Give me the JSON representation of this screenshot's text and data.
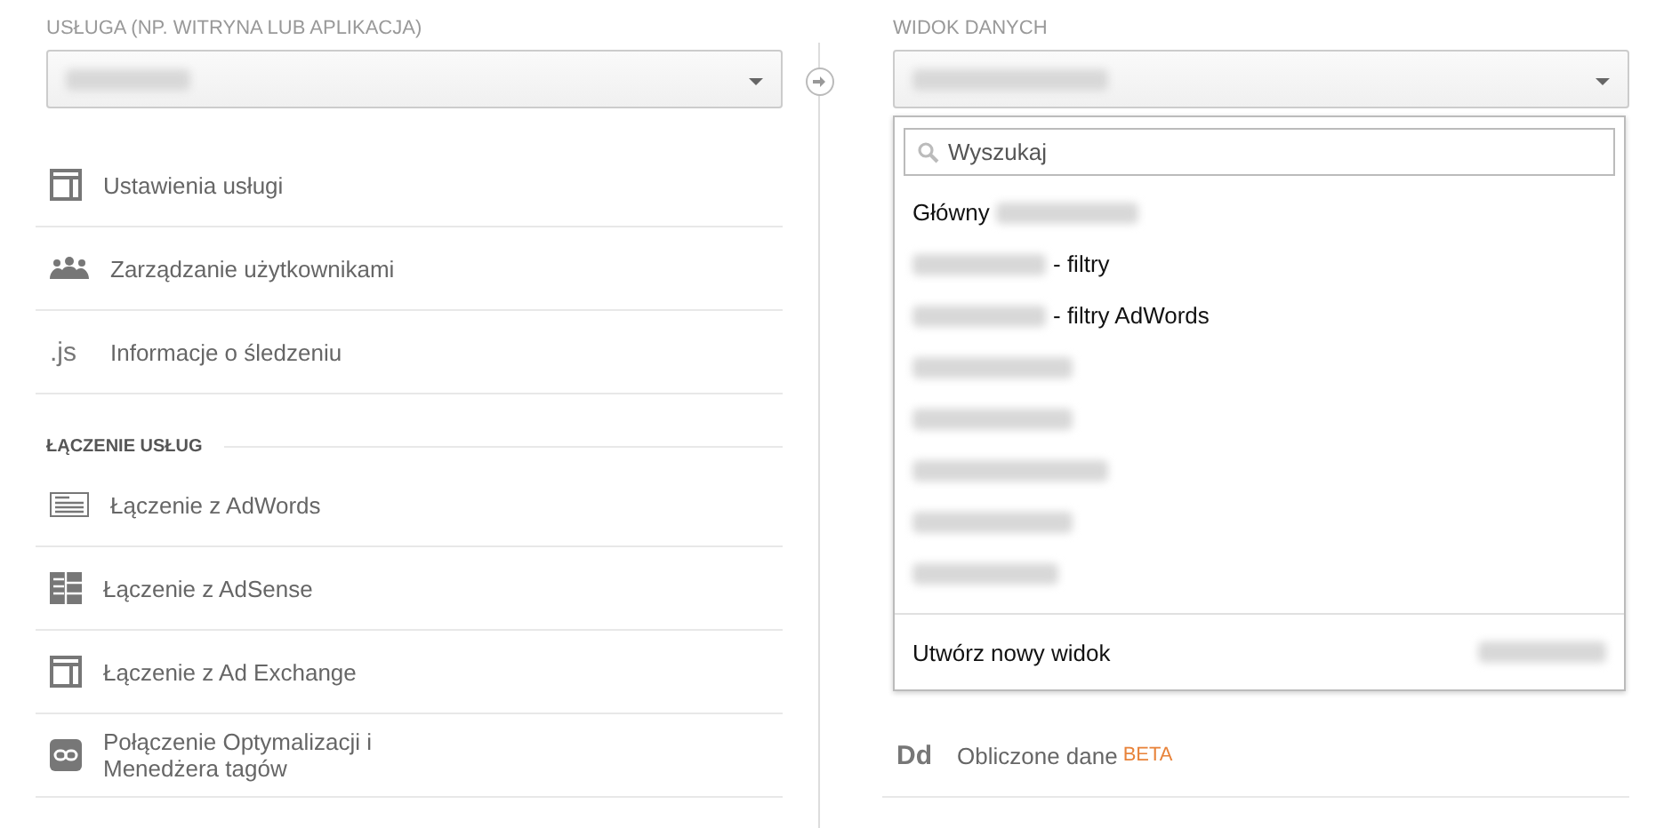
{
  "property": {
    "label": "USŁUGA (NP. WITRYNA LUB APLIKACJA)",
    "value_blurred": true
  },
  "property_items": [
    {
      "kind": "layout",
      "label": "Ustawienia usługi"
    },
    {
      "kind": "people",
      "label": "Zarządzanie użytkownikami"
    },
    {
      "kind": "text",
      "icon_text": ".js",
      "label": "Informacje o śledzeniu"
    }
  ],
  "linking": {
    "title": "ŁĄCZENIE USŁUG",
    "items": [
      {
        "kind": "lines",
        "label": "Łączenie z AdWords"
      },
      {
        "kind": "grid",
        "label": "Łączenie z AdSense"
      },
      {
        "kind": "layout",
        "label": "Łączenie z Ad Exchange"
      },
      {
        "kind": "link",
        "label": "Połączenie Optymalizacji i Menedżera tagów"
      }
    ]
  },
  "view": {
    "label": "WIDOK DANYCH",
    "value_blurred": true,
    "expanded": true,
    "menu": {
      "search_placeholder": "Wyszukaj",
      "items": [
        {
          "text": "Główny",
          "blur_before": false,
          "blur_after": true
        },
        {
          "text": "- filtry",
          "blur_before": true,
          "blur_after": false
        },
        {
          "text": "- filtry AdWords",
          "blur_before": true,
          "blur_after": false
        },
        {
          "blurred": true
        },
        {
          "blurred": true
        },
        {
          "blurred": true
        },
        {
          "blurred": true
        },
        {
          "blurred": true
        }
      ],
      "footer": {
        "label": "Utwórz nowy widok",
        "shortcut_blurred": true
      }
    }
  },
  "view_items": [
    {
      "kind": "text",
      "icon_text": "Dd",
      "label": "Obliczone dane",
      "badge": "BETA"
    }
  ]
}
